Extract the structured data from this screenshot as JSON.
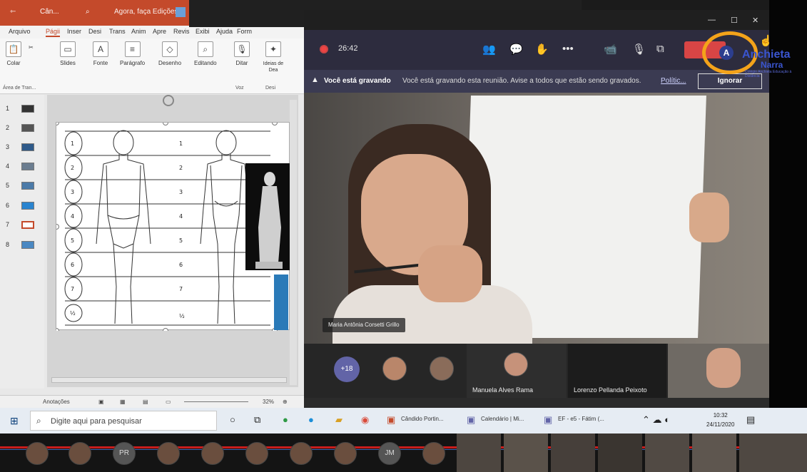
{
  "ppt": {
    "title_items": [
      "Cân...",
      "Agora, faça Edições"
    ],
    "tabs": [
      "Arquivo",
      "Págii",
      "Inser",
      "Desi",
      "Trans",
      "Anim",
      "Apre",
      "Revis",
      "Exibi",
      "Ajuda",
      "Form"
    ],
    "ribbon": {
      "paste": "Colar",
      "clipboard_group": "Área de Tran...",
      "slides": "Slides",
      "font": "Fonte",
      "paragraph": "Parágrafo",
      "drawing": "Desenho",
      "editing": "Editando",
      "dictate": "Ditar",
      "voice_group": "Voz",
      "design_ideas": "Ideias de Dea",
      "design_group": "Desi"
    },
    "slide_numbers": [
      "1",
      "2",
      "3",
      "4",
      "5",
      "6",
      "7",
      "8"
    ],
    "figure_numbers_left": [
      "1",
      "2",
      "3",
      "4",
      "5",
      "6",
      "7",
      "½"
    ],
    "figure_numbers_right": [
      "1",
      "2",
      "3",
      "4",
      "5",
      "6",
      "7",
      "½"
    ],
    "status": {
      "notes": "Anotações",
      "zoom": "32%"
    }
  },
  "teams": {
    "timer": "26:42",
    "recording_banner": {
      "title": "Você está gravando",
      "message": "Você está gravando esta reunião. Avise a todos que estão sendo gravados.",
      "policy_link": "Polític...",
      "ignore": "Ignorar"
    },
    "main_participant": "Maria Antônia Corsetti Grillo",
    "more_participants": "+18",
    "tiles": [
      {
        "name": "Manuela Alves Rama"
      },
      {
        "name": "Lorenzo Pellanda Peixoto"
      }
    ]
  },
  "watermark": {
    "line1": "Anchieta",
    "line2": "Narra",
    "sub": "Colégio Anchieta Educação à Distância"
  },
  "taskbar": {
    "search_placeholder": "Digite aqui para pesquisar",
    "apps": [
      "Cândido Portin...",
      "Calendário | Mi...",
      "EF - e5 - Fátim (..."
    ],
    "clock_time": "10:32",
    "clock_date": "24/11/2020"
  },
  "bottom_bar": {
    "initials": [
      "PR",
      "JM"
    ]
  },
  "colors": {
    "ppt_accent": "#c44a2b",
    "teams_bar": "#2d2c3e",
    "teams_purple": "#6264a7",
    "hangup_red": "#d84545",
    "logo_orange": "#f4a31a",
    "logo_blue": "#3a55d0"
  }
}
